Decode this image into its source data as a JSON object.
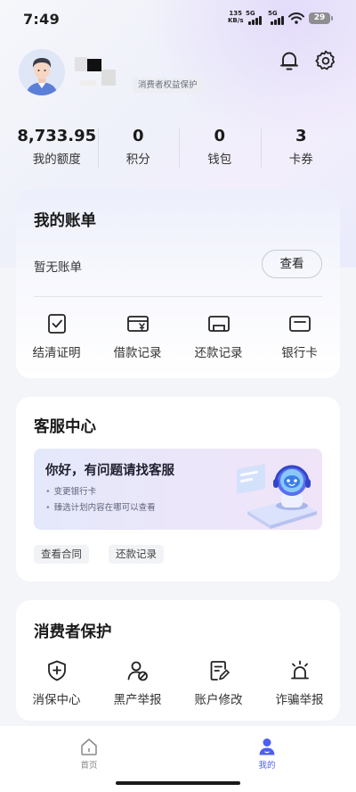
{
  "status_bar": {
    "time": "7:49",
    "net_speed_value": "135",
    "net_speed_unit": "KB/s",
    "sim1_tag": "5G",
    "sim2_tag": "5G",
    "battery": "29"
  },
  "profile": {
    "badge": "消费者权益保护"
  },
  "stats": [
    {
      "value": "8,733.95",
      "label": "我的额度"
    },
    {
      "value": "0",
      "label": "积分"
    },
    {
      "value": "0",
      "label": "钱包"
    },
    {
      "value": "3",
      "label": "卡券"
    }
  ],
  "bill": {
    "title": "我的账单",
    "empty_text": "暂无账单",
    "view_button": "查看",
    "actions": [
      {
        "label": "结清证明",
        "icon": "checked-document-icon"
      },
      {
        "label": "借款记录",
        "icon": "yuan-card-icon"
      },
      {
        "label": "还款记录",
        "icon": "repay-card-icon"
      },
      {
        "label": "银行卡",
        "icon": "bank-card-icon"
      }
    ]
  },
  "customer_service": {
    "title": "客服中心",
    "banner_headline": "你好，有问题请找客服",
    "banner_items": [
      "变更银行卡",
      "臻选计划内容在哪可以查看"
    ],
    "chips": [
      "查看合同",
      "还款记录"
    ]
  },
  "consumer_protection": {
    "title": "消费者保护",
    "items": [
      {
        "label": "消保中心",
        "icon": "shield-plus-icon"
      },
      {
        "label": "黑产举报",
        "icon": "user-block-icon"
      },
      {
        "label": "账户修改",
        "icon": "edit-document-icon"
      },
      {
        "label": "诈骗举报",
        "icon": "alarm-icon"
      }
    ]
  },
  "bottom_nav": {
    "home": "首页",
    "mine": "我的"
  },
  "colors": {
    "accent": "#4d5ef0",
    "card_bg": "#ffffff",
    "page_bg": "#f4f5f9"
  }
}
